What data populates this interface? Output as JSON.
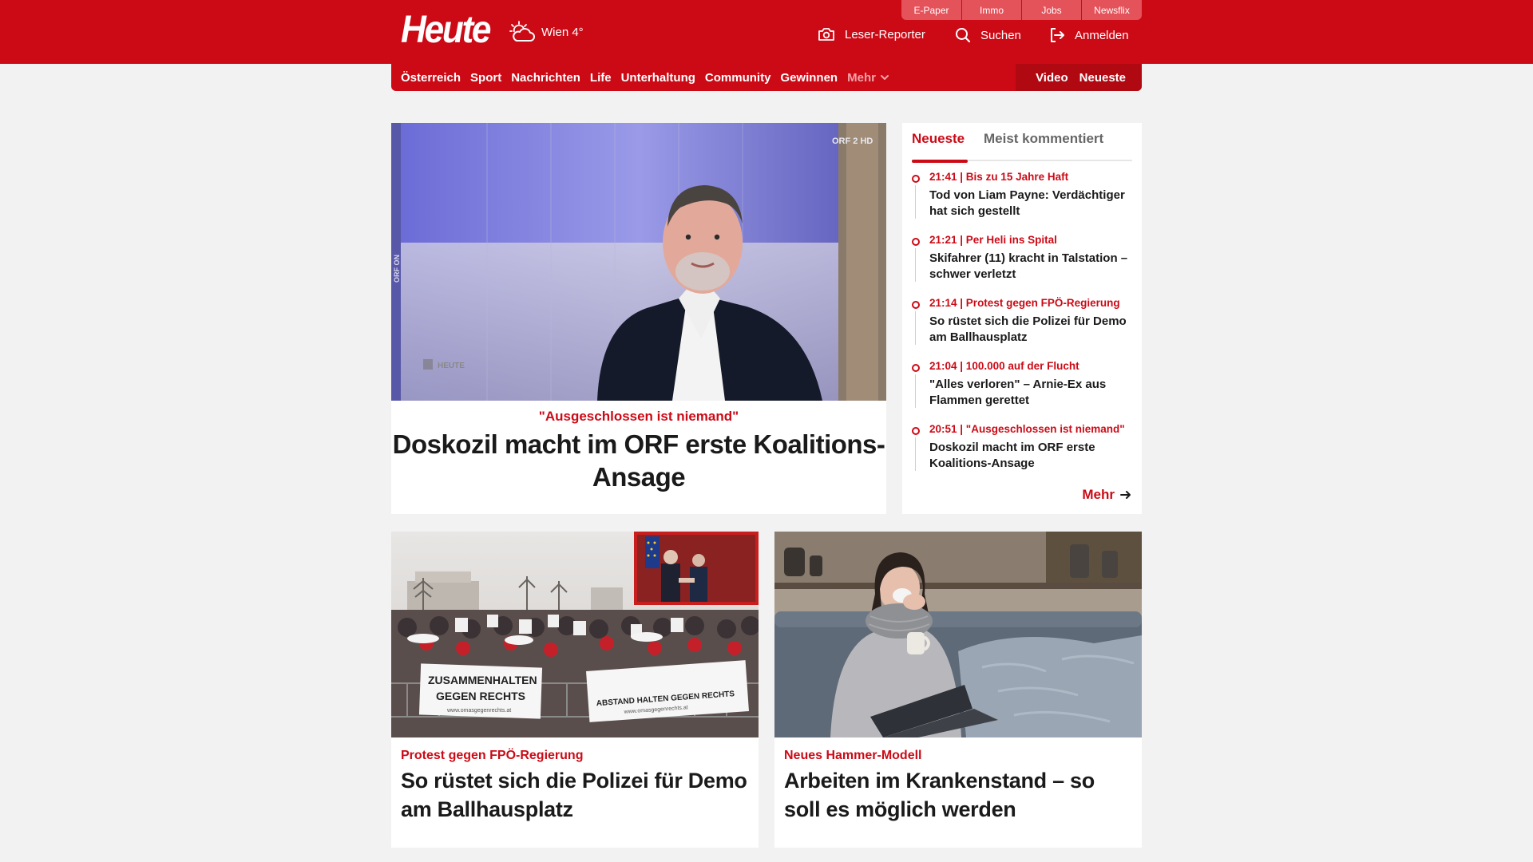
{
  "header": {
    "logo": "Heute",
    "weather": {
      "icon": "cloud-sun-icon",
      "label": "Wien 4°"
    },
    "pills": [
      "E-Paper",
      "Immo",
      "Jobs",
      "Newsflix"
    ],
    "actions": {
      "reporter": "Leser-Reporter",
      "search": "Suchen",
      "login": "Anmelden"
    }
  },
  "nav": {
    "items": [
      "Österreich",
      "Sport",
      "Nachrichten",
      "Life",
      "Unterhaltung",
      "Community",
      "Gewinnen"
    ],
    "more": "Mehr",
    "video": "Video",
    "latest": "Neueste"
  },
  "hero": {
    "image_overlay_top": "ORF 2 HD",
    "image_overlay_side": "ORF ON",
    "image_overlay_bottom": "HEUTE",
    "kicker": "\"Ausgeschlossen ist niemand\"",
    "title": "Doskozil macht im ORF erste Koalitions-Ansage"
  },
  "sidebar": {
    "tab_active": "Neueste",
    "tab_inactive": "Meist kommentiert",
    "items": [
      {
        "meta": "21:41 | Bis zu 15 Jahre Haft",
        "title": "Tod von Liam Payne: Verdächtiger hat sich gestellt"
      },
      {
        "meta": "21:21 | Per Heli ins Spital",
        "title": "Skifahrer (11) kracht in Talstation – schwer verletzt"
      },
      {
        "meta": "21:14 | Protest gegen FPÖ-Regierung",
        "title": "So rüstet sich die Polizei für Demo am Ballhausplatz"
      },
      {
        "meta": "21:04 | 100.000 auf der Flucht",
        "title": "\"Alles verloren\" – Arnie-Ex aus Flammen gerettet"
      },
      {
        "meta": "20:51 | \"Ausgeschlossen ist niemand\"",
        "title": "Doskozil macht im ORF erste Koalitions-Ansage"
      }
    ],
    "more": "Mehr"
  },
  "cards": [
    {
      "kicker": "Protest gegen FPÖ-Regierung",
      "title": "So rüstet sich die Polizei für Demo am Ballhausplatz",
      "banner_left_1": "ZUSAMMENHALTEN",
      "banner_left_2": "GEGEN RECHTS",
      "banner_left_url": "www.omasgegenrechts.at",
      "banner_right": "ABSTAND HALTEN GEGEN RECHTS",
      "banner_right_url": "www.omasgegenrechts.at"
    },
    {
      "kicker": "Neues Hammer-Modell",
      "title": "Arbeiten im Krankenstand – so soll es möglich werden"
    }
  ]
}
